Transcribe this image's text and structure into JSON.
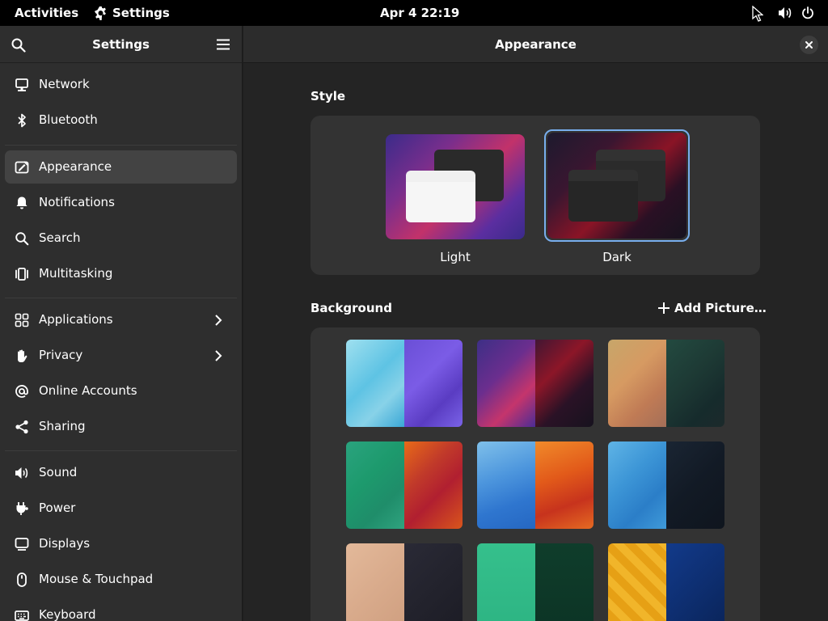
{
  "topbar": {
    "activities": "Activities",
    "app_name": "Settings",
    "clock": "Apr 4  22:19"
  },
  "sidebar": {
    "title": "Settings",
    "items": [
      {
        "label": "Network",
        "icon": "network-icon"
      },
      {
        "label": "Bluetooth",
        "icon": "bluetooth-icon"
      },
      {
        "label": "Appearance",
        "icon": "appearance-icon"
      },
      {
        "label": "Notifications",
        "icon": "bell-icon"
      },
      {
        "label": "Search",
        "icon": "search-icon"
      },
      {
        "label": "Multitasking",
        "icon": "multitasking-icon"
      },
      {
        "label": "Applications",
        "icon": "grid-icon"
      },
      {
        "label": "Privacy",
        "icon": "hand-icon"
      },
      {
        "label": "Online Accounts",
        "icon": "at-icon"
      },
      {
        "label": "Sharing",
        "icon": "share-icon"
      },
      {
        "label": "Sound",
        "icon": "speaker-icon"
      },
      {
        "label": "Power",
        "icon": "power-plug-icon"
      },
      {
        "label": "Displays",
        "icon": "display-icon"
      },
      {
        "label": "Mouse & Touchpad",
        "icon": "mouse-icon"
      },
      {
        "label": "Keyboard",
        "icon": "keyboard-icon"
      }
    ],
    "active_item": "Appearance"
  },
  "main": {
    "title": "Appearance",
    "style": {
      "label": "Style",
      "options": [
        {
          "label": "Light",
          "selected": false
        },
        {
          "label": "Dark",
          "selected": true
        }
      ]
    },
    "background": {
      "label": "Background",
      "add_button": "Add Picture…"
    }
  },
  "colors": {
    "accent": "#78aeed",
    "sidebar_bg": "#2e2e2e",
    "main_bg": "#242424",
    "card_bg": "#333333",
    "active_row": "#434343"
  }
}
